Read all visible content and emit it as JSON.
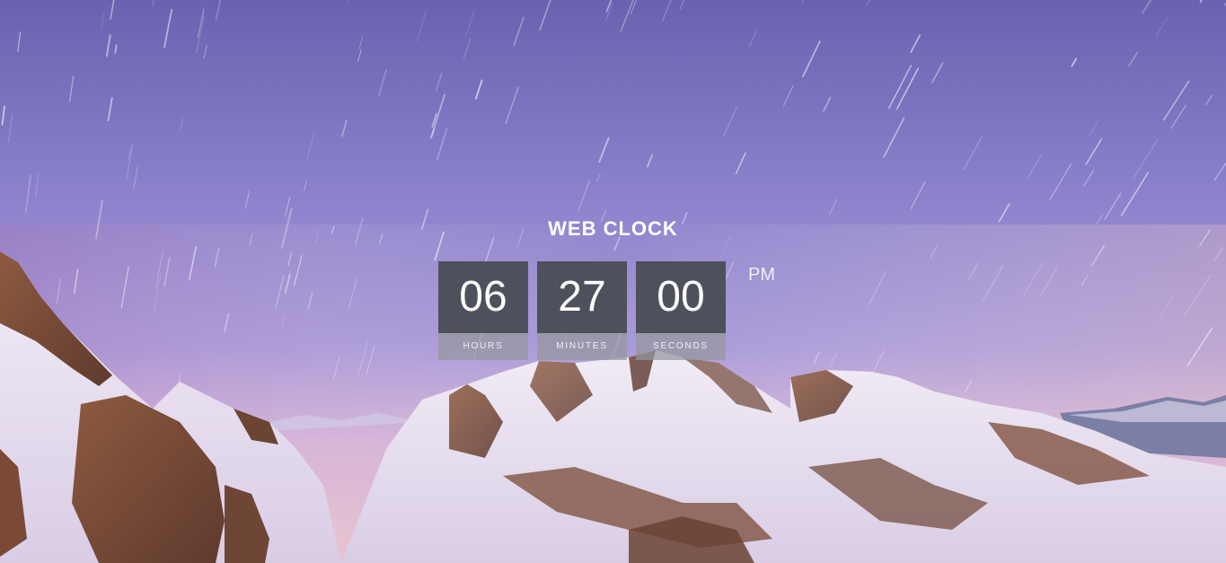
{
  "clock": {
    "title": "WEB CLOCK",
    "hours": "06",
    "minutes": "27",
    "seconds": "00",
    "ampm": "PM",
    "labels": {
      "hours": "HOURS",
      "minutes": "MINUTES",
      "seconds": "SECONDS"
    }
  },
  "colors": {
    "sky_top": "#6b63b3",
    "sky_mid": "#9a8ad4",
    "horizon_glow": "#e6b6c8",
    "snow": "#e9e1ee",
    "rock": "#7a4a36",
    "digit_box": "#4b4e58",
    "label_box": "#96969e",
    "text": "#ffffff"
  }
}
